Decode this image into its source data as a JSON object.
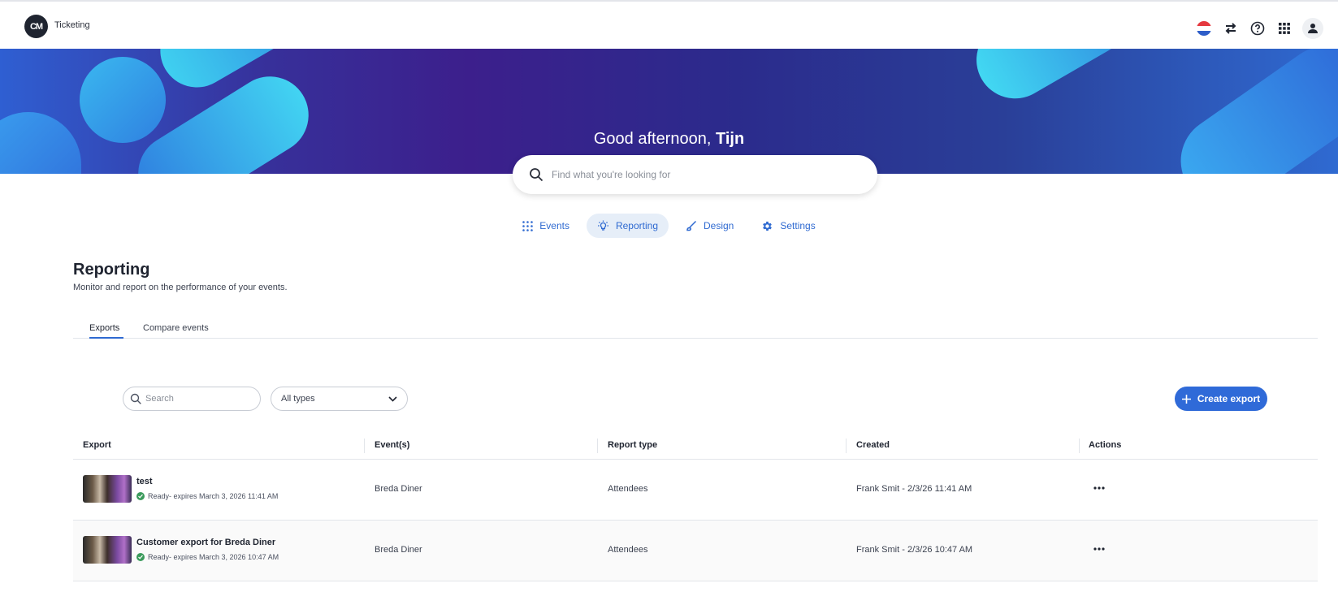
{
  "app": {
    "name": "Ticketing",
    "logo_text": "CM"
  },
  "topbar": {
    "icons": [
      "flag-icon",
      "switch-icon",
      "help-icon",
      "apps-grid-icon",
      "user-icon"
    ]
  },
  "hero": {
    "greeting_prefix": "Good afternoon,",
    "user_name": "Tijn"
  },
  "search": {
    "placeholder": "Find what you're looking for"
  },
  "nav": {
    "items": [
      {
        "label": "Events",
        "icon": "grid-icon",
        "active": false
      },
      {
        "label": "Reporting",
        "icon": "lightbulb-icon",
        "active": true
      },
      {
        "label": "Design",
        "icon": "brush-icon",
        "active": false
      },
      {
        "label": "Settings",
        "icon": "gear-icon",
        "active": false
      }
    ]
  },
  "page": {
    "title": "Reporting",
    "subtitle": "Monitor and report on the performance of your events."
  },
  "tabs": [
    {
      "label": "Exports",
      "active": true
    },
    {
      "label": "Compare events",
      "active": false
    }
  ],
  "filters": {
    "search_placeholder": "Search",
    "type_selected": "All types"
  },
  "create_button": {
    "label": "Create export"
  },
  "table": {
    "headers": [
      "Export",
      "Event(s)",
      "Report type",
      "Created",
      "Actions"
    ],
    "rows": [
      {
        "name": "test",
        "status": "Ready- expires March 3, 2026 11:41 AM",
        "event": "Breda Diner",
        "report_type": "Attendees",
        "created": "Frank Smit - 2/3/26 11:41 AM"
      },
      {
        "name": "Customer export for Breda Diner",
        "status": "Ready- expires March 3, 2026 10:47 AM",
        "event": "Breda Diner",
        "report_type": "Attendees",
        "created": "Frank Smit - 2/3/26 10:47 AM"
      }
    ]
  },
  "colors": {
    "accent": "#2f6ad8",
    "success": "#3a9a5b",
    "hero_dark": "#3c1f8c"
  }
}
